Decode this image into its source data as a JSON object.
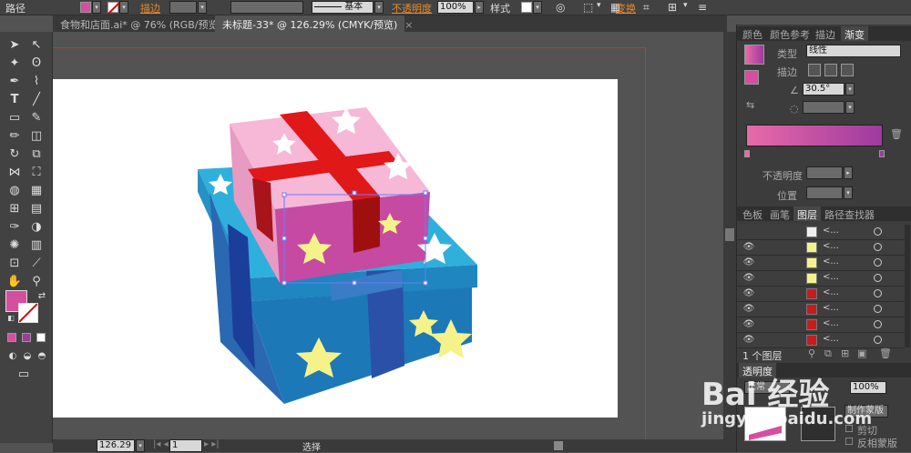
{
  "control_bar": {
    "path_label": "路径",
    "stroke_label": "描边",
    "stroke_style": "基本",
    "opacity_label": "不透明度",
    "opacity_value": "100%",
    "style_label": "样式",
    "transform_label": "变换"
  },
  "tabs": [
    {
      "label": "食物和店面.ai* @ 76% (RGB/预览)",
      "close": "×"
    },
    {
      "label": "未标题-33* @ 126.29% (CMYK/预览)",
      "close": "×"
    }
  ],
  "status_bar": {
    "zoom": "126.29",
    "page": "1",
    "tool": "选择"
  },
  "gradient_panel": {
    "tabs": [
      "颜色",
      "颜色参考",
      "描边",
      "渐变"
    ],
    "type_label": "类型",
    "type_value": "线性",
    "stroke_label": "描边",
    "angle_value": "30.5°",
    "opacity_label": "不透明度",
    "position_label": "位置",
    "colors": {
      "start": "#e86aa8",
      "end": "#9e3aa0"
    }
  },
  "layers_panel": {
    "tabs": [
      "色板",
      "画笔",
      "图层",
      "路径查找器"
    ],
    "rows": [
      {
        "name": "<...",
        "thumb": "#eeeeee"
      },
      {
        "name": "<...",
        "thumb": "#f6f28a"
      },
      {
        "name": "<...",
        "thumb": "#f6f28a"
      },
      {
        "name": "<...",
        "thumb": "#f6f28a"
      },
      {
        "name": "<...",
        "thumb": "#c81c1c"
      },
      {
        "name": "<...",
        "thumb": "#c81c1c"
      },
      {
        "name": "<...",
        "thumb": "#c81c1c"
      },
      {
        "name": "<...",
        "thumb": "#c81c1c"
      }
    ],
    "footer": "1 个图层"
  },
  "transparency_panel": {
    "tab": "透明度",
    "mode": "正常",
    "opacity": "100%",
    "make_mask": "制作蒙版",
    "clip": "剪切",
    "invert_mask": "反相蒙版"
  },
  "watermark": {
    "brand": "Bai 经验",
    "url": "jingyan.baidu.com"
  },
  "colors": {
    "fill": "#d44fa0",
    "box_blue": "#2a9fd0",
    "box_dark_blue": "#1f5aa8",
    "lid_pink": "#f6b8d6",
    "ribbon_red": "#e01818",
    "star_yellow": "#f6f28a"
  }
}
